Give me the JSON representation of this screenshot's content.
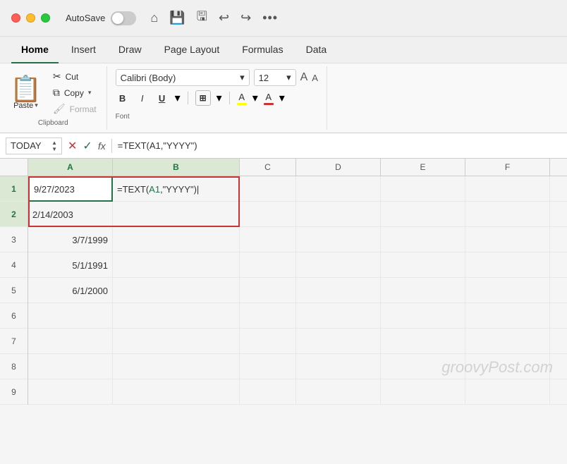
{
  "titleBar": {
    "autosave": "AutoSave",
    "icons": [
      "home",
      "save",
      "saveCloud",
      "undo",
      "redo",
      "more"
    ]
  },
  "tabs": [
    {
      "label": "Home",
      "active": true
    },
    {
      "label": "Insert",
      "active": false
    },
    {
      "label": "Draw",
      "active": false
    },
    {
      "label": "Page Layout",
      "active": false
    },
    {
      "label": "Formulas",
      "active": false
    },
    {
      "label": "Data",
      "active": false
    }
  ],
  "ribbon": {
    "paste": "Paste",
    "cut": "Cut",
    "copy": "Copy",
    "format": "Format",
    "font": "Calibri (Body)",
    "fontSize": "12",
    "fontSection": "Font"
  },
  "formulaBar": {
    "nameBox": "TODAY",
    "formula": "=TEXT(A1,\"YYYY\")"
  },
  "columns": [
    "A",
    "B",
    "C",
    "D",
    "E",
    "F"
  ],
  "rows": [
    {
      "num": "1",
      "a": "9/27/2023",
      "b": "=TEXT(A1,\"YYYY\")",
      "c": "",
      "d": "",
      "e": "",
      "f": ""
    },
    {
      "num": "2",
      "a": "2/14/2003",
      "b": "",
      "c": "",
      "d": "",
      "e": "",
      "f": ""
    },
    {
      "num": "3",
      "a": "3/7/1999",
      "b": "",
      "c": "",
      "d": "",
      "e": "",
      "f": ""
    },
    {
      "num": "4",
      "a": "5/1/1991",
      "b": "",
      "c": "",
      "d": "",
      "e": "",
      "f": ""
    },
    {
      "num": "5",
      "a": "6/1/2000",
      "b": "",
      "c": "",
      "d": "",
      "e": "",
      "f": ""
    },
    {
      "num": "6",
      "a": "",
      "b": "",
      "c": "",
      "d": "",
      "e": "",
      "f": ""
    },
    {
      "num": "7",
      "a": "",
      "b": "",
      "c": "",
      "d": "",
      "e": "",
      "f": ""
    },
    {
      "num": "8",
      "a": "",
      "b": "",
      "c": "",
      "d": "",
      "e": "",
      "f": ""
    },
    {
      "num": "9",
      "a": "",
      "b": "",
      "c": "",
      "d": "",
      "e": "",
      "f": ""
    }
  ],
  "watermark": "groovyPost.com"
}
